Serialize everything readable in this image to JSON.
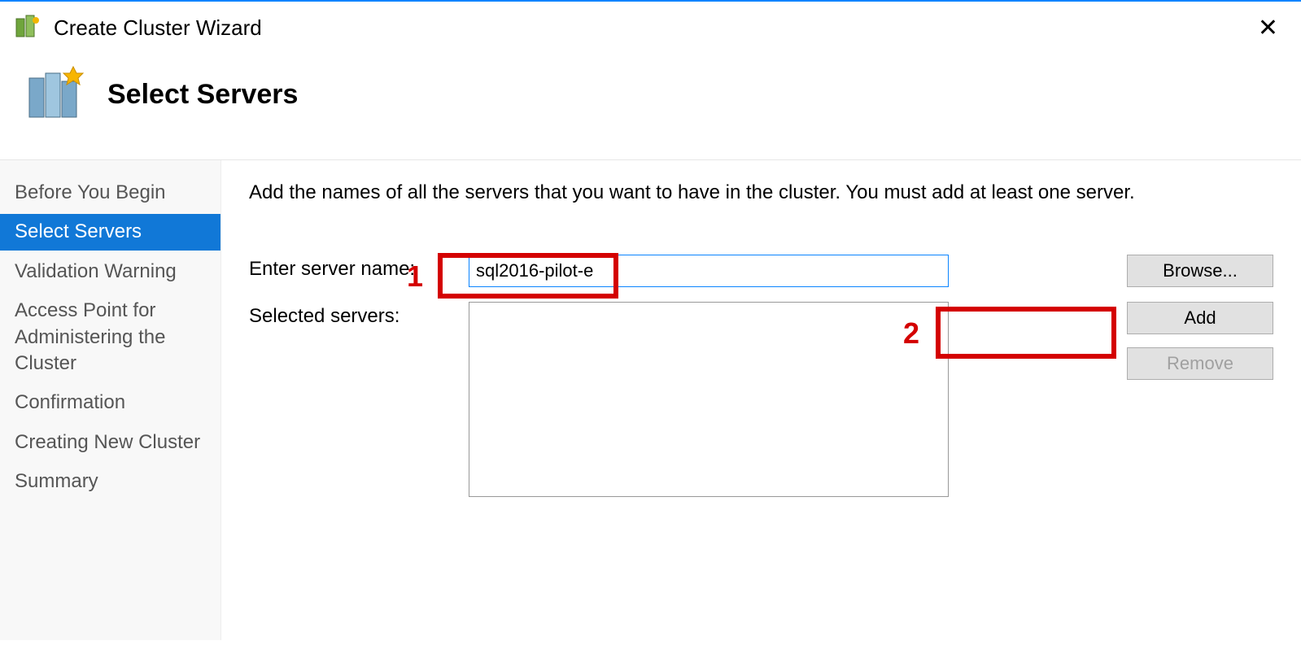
{
  "titlebar": {
    "title": "Create Cluster Wizard"
  },
  "header": {
    "heading": "Select Servers"
  },
  "sidebar": {
    "items": [
      "Before You Begin",
      "Select Servers",
      "Validation Warning",
      "Access Point for Administering the Cluster",
      "Confirmation",
      "Creating New Cluster",
      "Summary"
    ],
    "active_index": 1
  },
  "main": {
    "instruction": "Add the names of all the servers that you want to have in the cluster. You must add at least one server.",
    "enter_label": "Enter server name:",
    "server_name_value": "sql2016-pilot-e",
    "selected_label": "Selected servers:",
    "browse_button": "Browse...",
    "add_button": "Add",
    "remove_button": "Remove"
  },
  "annotations": {
    "num1": "1",
    "num2": "2"
  }
}
